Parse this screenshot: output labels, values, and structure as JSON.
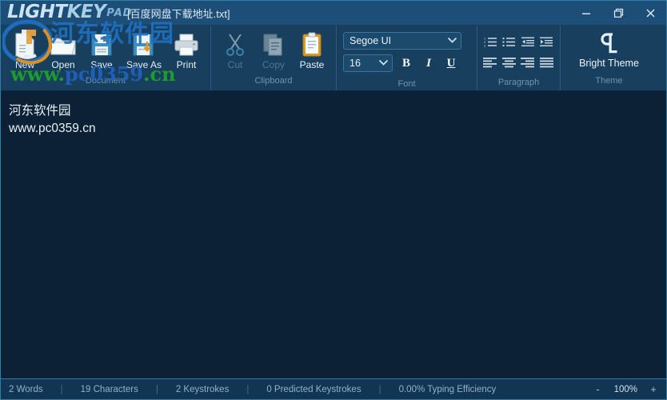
{
  "window": {
    "logo_primary": "LIGHT",
    "logo_secondary": "KEY",
    "logo_suffix": "PAD",
    "filename": "[百度网盘下载地址.txt]",
    "controls": {
      "minimize": "minimize-button",
      "restore": "restore-button",
      "close": "close-button"
    }
  },
  "ribbon": {
    "groups": [
      {
        "label": "Document",
        "commands": [
          {
            "label": "New",
            "icon": "new-document-icon",
            "enabled": true
          },
          {
            "label": "Open",
            "icon": "open-folder-icon",
            "enabled": true
          },
          {
            "label": "Save",
            "icon": "save-disk-icon",
            "enabled": true
          },
          {
            "label": "Save As",
            "icon": "save-as-icon",
            "enabled": true
          },
          {
            "label": "Print",
            "icon": "printer-icon",
            "enabled": true
          }
        ]
      },
      {
        "label": "Clipboard",
        "commands": [
          {
            "label": "Cut",
            "icon": "scissors-icon",
            "enabled": false
          },
          {
            "label": "Copy",
            "icon": "copy-pages-icon",
            "enabled": false
          },
          {
            "label": "Paste",
            "icon": "clipboard-icon",
            "enabled": true
          }
        ]
      },
      {
        "label": "Font",
        "font_name": "Segoe UI",
        "font_size": "16",
        "bold_label": "B",
        "italic_label": "I",
        "underline_label": "U"
      },
      {
        "label": "Paragraph",
        "buttons": [
          "numbered-list-icon",
          "bulleted-list-icon",
          "decrease-indent-icon",
          "increase-indent-icon",
          "align-left-icon",
          "align-center-icon",
          "align-right-icon",
          "justify-icon"
        ]
      },
      {
        "label": "Theme",
        "theme_button": "Bright Theme",
        "theme_icon": "pilcrow-theme-icon"
      }
    ]
  },
  "document": {
    "lines": [
      "河东软件园",
      "www.pc0359.cn"
    ]
  },
  "status": {
    "words": "2 Words",
    "characters": "19 Characters",
    "keystrokes": "2 Keystrokes",
    "predicted": "0 Predicted Keystrokes",
    "efficiency": "0.00% Typing Efficiency",
    "separator": "|",
    "zoom_out": "-",
    "zoom_value": "100%",
    "zoom_in": "+"
  },
  "watermarks": {
    "chinese": "河东软件园",
    "url_part1": "www.",
    "url_part2": "pc0359",
    "url_part3": ".cn"
  },
  "colors": {
    "titlebar": "#1d4e77",
    "ribbon": "#18405e",
    "document_bg": "#0d2136",
    "statusbar": "#123553",
    "accent": "#2e7fa8",
    "watermark_green": "#1d9b2f",
    "watermark_blue": "#1f6fc0"
  }
}
